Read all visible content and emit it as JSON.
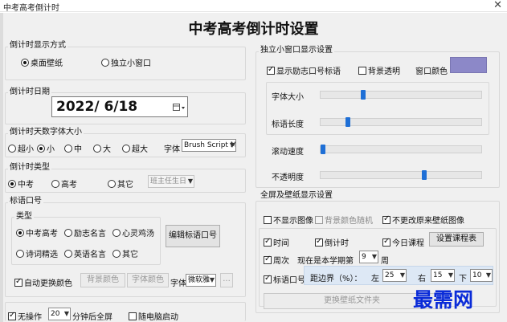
{
  "window": {
    "title": "中考高考倒计时",
    "close_glyph": "✕"
  },
  "heading": "中考高考倒计时设置",
  "display_mode": {
    "legend": "倒计时显示方式",
    "options": [
      "桌面壁纸",
      "独立小窗口"
    ],
    "selected": 0
  },
  "date": {
    "legend": "倒计时日期",
    "value": "2022/  6/18",
    "picker_icon": "calendar-icon"
  },
  "font_size": {
    "legend": "倒计时天数字体大小",
    "options": [
      "超小",
      "小",
      "中",
      "大",
      "超大"
    ],
    "selected": 1,
    "font_label": "字体",
    "font_value": "Brush Script M"
  },
  "countdown_type": {
    "legend": "倒计时类型",
    "options": [
      "中考",
      "高考",
      "其它"
    ],
    "selected": 0,
    "other_value": "班主任生日"
  },
  "slogan": {
    "legend": "标语口号",
    "type_legend": "类型",
    "types": [
      "中考高考",
      "励志名言",
      "心灵鸡汤",
      "诗词精选",
      "英语名言",
      "其它"
    ],
    "selected": 0,
    "edit_button": "编辑标语口号",
    "auto_color_label": "自动更换颜色",
    "auto_color_checked": true,
    "bg_color_button": "背景颜色",
    "font_color_button": "字体颜色",
    "font_label": "字体",
    "font_value": "微软雅",
    "more_button": "..."
  },
  "bottom": {
    "no_op_label": "无操作",
    "no_op_checked": true,
    "minutes": "20",
    "minutes_suffix": "分钟后全屏",
    "autostart_label": "随电脑启动",
    "autostart_checked": false
  },
  "small_window": {
    "legend": "独立小窗口显示设置",
    "show_slogan_label": "显示励志口号标语",
    "show_slogan_checked": true,
    "transparent_label": "背景透明",
    "transparent_checked": false,
    "window_color_label": "窗口颜色",
    "window_color": "#8c88c8",
    "sliders": [
      {
        "label": "字体大小",
        "value": 0.26
      },
      {
        "label": "标语长度",
        "value": 0.16
      },
      {
        "label": "滚动速度",
        "value": 0.0
      },
      {
        "label": "不透明度",
        "value": 0.65
      }
    ]
  },
  "fullscreen": {
    "legend": "全屏及壁纸显示设置",
    "no_image_label": "不显示图像",
    "no_image_checked": false,
    "bg_random_label": "背景颜色随机",
    "bg_random_checked": false,
    "keep_wallpaper_label": "不更改原来壁纸图像",
    "keep_wallpaper_checked": true,
    "time_label": "时间",
    "time_checked": true,
    "countdown_label": "倒计时",
    "countdown_checked": true,
    "today_label": "今日课程",
    "today_checked": true,
    "set_course_button": "设置课程表",
    "week_label": "周次",
    "week_checked": true,
    "week_prefix": "现在是本学期第",
    "week_value": "9",
    "week_suffix": "周",
    "slogan_label": "标语口号",
    "slogan_checked": true,
    "margin_label": "距边界（%）：",
    "left_label": "左",
    "left_value": "25",
    "right_label": "右",
    "right_value": "15",
    "bottom_label": "下",
    "bottom_value": "10",
    "change_wallpaper_button": "更换壁纸文件夹"
  },
  "watermark": "最需网"
}
